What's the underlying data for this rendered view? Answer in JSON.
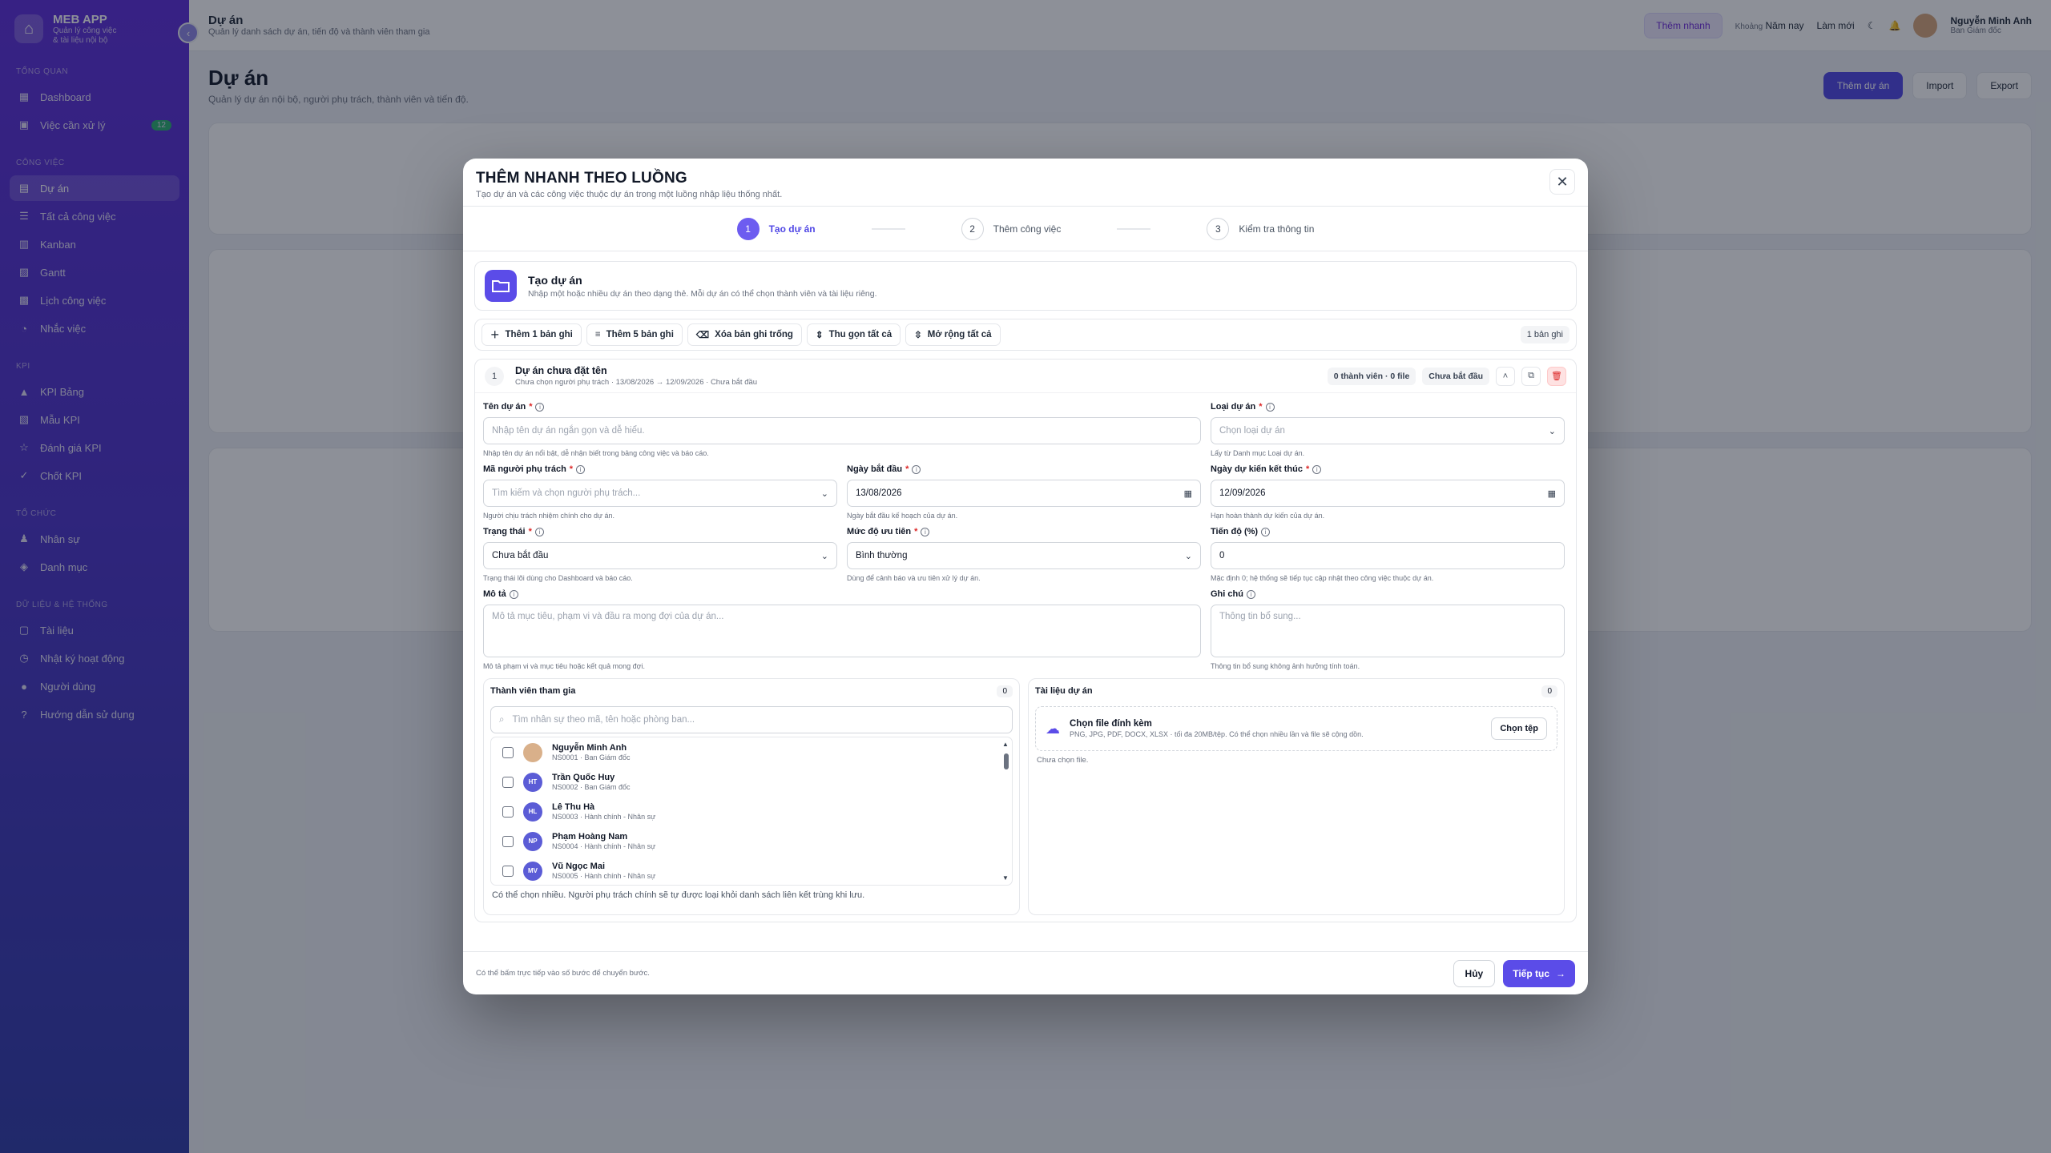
{
  "app": {
    "name": "MEB APP",
    "subtitle_1": "Quản lý công việc",
    "subtitle_2": "& tài liệu nội bộ"
  },
  "sidebar": {
    "sections": [
      {
        "title": "Tổng quan",
        "items": [
          {
            "label": "Dashboard",
            "icon": "grid-icon"
          },
          {
            "label": "Việc cần xử lý",
            "icon": "inbox-icon",
            "badge": "12"
          }
        ]
      },
      {
        "title": "Công việc",
        "items": [
          {
            "label": "Dự án",
            "icon": "folder-icon",
            "active": true
          },
          {
            "label": "Tất cả công việc",
            "icon": "list-icon"
          },
          {
            "label": "Kanban",
            "icon": "kanban-icon"
          },
          {
            "label": "Gantt",
            "icon": "gantt-icon"
          },
          {
            "label": "Lịch công việc",
            "icon": "calendar-icon"
          },
          {
            "label": "Nhắc việc",
            "icon": "bell-icon"
          }
        ]
      },
      {
        "title": "KPI",
        "items": [
          {
            "label": "KPI Bảng",
            "icon": "chart-icon"
          },
          {
            "label": "Mẫu KPI",
            "icon": "template-icon"
          },
          {
            "label": "Đánh giá KPI",
            "icon": "star-icon"
          },
          {
            "label": "Chốt KPI",
            "icon": "check-icon"
          }
        ]
      },
      {
        "title": "Tổ chức",
        "items": [
          {
            "label": "Nhân sự",
            "icon": "users-icon"
          },
          {
            "label": "Danh mục",
            "icon": "tag-icon"
          }
        ]
      },
      {
        "title": "Dữ liệu & Hệ thống",
        "items": [
          {
            "label": "Tài liệu",
            "icon": "file-icon"
          },
          {
            "label": "Nhật ký hoạt động",
            "icon": "history-icon"
          },
          {
            "label": "Người dùng",
            "icon": "user-icon"
          },
          {
            "label": "Hướng dẫn sử dụng",
            "icon": "help-icon"
          }
        ]
      }
    ]
  },
  "topbar": {
    "title": "Dự án",
    "subtitle": "Quản lý danh sách dự án, tiến độ và thành viên tham gia",
    "quick_add": "Thêm nhanh",
    "range_label": "Khoảng",
    "range_value": "Năm nay",
    "refresh": "Làm mới",
    "user_name": "Nguyễn Minh Anh",
    "user_role": "Ban Giám đốc"
  },
  "page": {
    "title": "Dự án",
    "subtitle": "Quản lý dự án nội bộ, người phụ trách, thành viên và tiến độ.",
    "add_button": "Thêm dự án",
    "import": "Import",
    "export": "Export"
  },
  "modal": {
    "title": "THÊM NHANH THEO LUỒNG",
    "subtitle": "Tạo dự án và các công việc thuộc dự án trong một luồng nhập liệu thống nhất.",
    "steps": [
      {
        "num": "1",
        "label": "Tạo dự án"
      },
      {
        "num": "2",
        "label": "Thêm công việc"
      },
      {
        "num": "3",
        "label": "Kiểm tra thông tin"
      }
    ],
    "section_title": "Tạo dự án",
    "section_sub": "Nhập một hoặc nhiều dự án theo dạng thẻ. Mỗi dự án có thể chọn thành viên và tài liệu riêng.",
    "toolbar": {
      "add_one": "Thêm 1 bản ghi",
      "add_five": "Thêm 5 bản ghi",
      "remove_empty": "Xóa bản ghi trống",
      "collapse_all": "Thu gọn tất cả",
      "expand_all": "Mở rộng tất cả",
      "count": "1 bản ghi"
    },
    "record": {
      "num": "1",
      "name": "Dự án chưa đặt tên",
      "meta": "Chưa chọn người phụ trách · 13/08/2026 → 12/09/2026 · Chưa bắt đầu",
      "pill_members": "0 thành viên · 0 file",
      "pill_status": "Chưa bắt đầu"
    },
    "fields": {
      "name": {
        "label": "Tên dự án",
        "placeholder": "Nhập tên dự án ngắn gọn và dễ hiểu.",
        "hint": "Nhập tên dự án nổi bật, dễ nhận biết trong bảng công việc và báo cáo."
      },
      "type": {
        "label": "Loại dự án",
        "placeholder": "Chọn loại dự án",
        "hint": "Lấy từ Danh mục Loại dự án."
      },
      "owner": {
        "label": "Mã người phụ trách",
        "placeholder": "Tìm kiếm và chọn người phụ trách...",
        "hint": "Người chịu trách nhiệm chính cho dự án."
      },
      "start": {
        "label": "Ngày bắt đầu",
        "value": "13/08/2026",
        "hint": "Ngày bắt đầu kế hoạch của dự án."
      },
      "end": {
        "label": "Ngày dự kiến kết thúc",
        "value": "12/09/2026",
        "hint": "Hạn hoàn thành dự kiến của dự án."
      },
      "status": {
        "label": "Trạng thái",
        "value": "Chưa bắt đầu",
        "hint": "Trạng thái lõi dùng cho Dashboard và báo cáo."
      },
      "priority": {
        "label": "Mức độ ưu tiên",
        "value": "Bình thường",
        "hint": "Dùng để cảnh báo và ưu tiên xử lý dự án."
      },
      "progress": {
        "label": "Tiến độ (%)",
        "value": "0",
        "hint": "Mặc định 0; hệ thống sẽ tiếp tục cập nhật theo công việc thuộc dự án."
      },
      "desc": {
        "label": "Mô tả",
        "placeholder": "Mô tả mục tiêu, phạm vi và đầu ra mong đợi của dự án...",
        "hint": "Mô tả phạm vi và mục tiêu hoặc kết quả mong đợi."
      },
      "note": {
        "label": "Ghi chú",
        "placeholder": "Thông tin bổ sung...",
        "hint": "Thông tin bổ sung không ảnh hưởng tính toán."
      }
    },
    "members": {
      "title": "Thành viên tham gia",
      "count": "0",
      "search_placeholder": "Tìm nhân sự theo mã, tên hoặc phòng ban...",
      "list": [
        {
          "initials": "",
          "name": "Nguyễn Minh Anh",
          "desc": "NS0001 · Ban Giám đốc"
        },
        {
          "initials": "HT",
          "name": "Trần Quốc Huy",
          "desc": "NS0002 · Ban Giám đốc"
        },
        {
          "initials": "HL",
          "name": "Lê Thu Hà",
          "desc": "NS0003 · Hành chính - Nhân sự"
        },
        {
          "initials": "NP",
          "name": "Phạm Hoàng Nam",
          "desc": "NS0004 · Hành chính - Nhân sự"
        },
        {
          "initials": "MV",
          "name": "Vũ Ngọc Mai",
          "desc": "NS0005 · Hành chính - Nhân sự"
        }
      ],
      "note": "Có thể chọn nhiều. Người phụ trách chính sẽ tự được loại khỏi danh sách liên kết trùng khi lưu."
    },
    "documents": {
      "title": "Tài liệu dự án",
      "count": "0",
      "upload_title": "Chọn file đính kèm",
      "upload_sub": "PNG, JPG, PDF, DOCX, XLSX · tối đa 20MB/tệp. Có thể chọn nhiều lần và file sẽ cộng dồn.",
      "upload_button": "Chọn tệp",
      "empty": "Chưa chọn file."
    },
    "footer": {
      "note": "Có thể bấm trực tiếp vào số bước để chuyển bước.",
      "cancel": "Hủy",
      "next": "Tiếp tục"
    }
  }
}
